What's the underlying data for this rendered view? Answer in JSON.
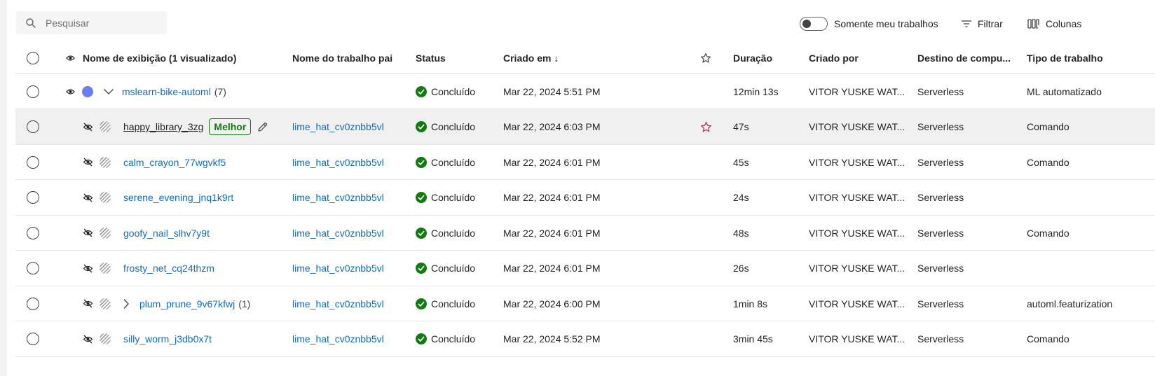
{
  "toolbar": {
    "search_placeholder": "Pesquisar",
    "toggle_label": "Somente meu trabalhos",
    "filter_label": "Filtrar",
    "columns_label": "Colunas"
  },
  "columns": {
    "display_name": "Nome de exibição (1 visualizado)",
    "parent_job": "Nome do trabalho pai",
    "status": "Status",
    "created_on": "Criado em ↓",
    "duration": "Duração",
    "created_by": "Criado por",
    "compute_target": "Destino de compu...",
    "job_type": "Tipo de trabalho"
  },
  "parent_row": {
    "name": "mslearn-bike-automl",
    "count": "(7)",
    "status": "Concluído",
    "created": "Mar 22, 2024 5:51 PM",
    "duration": "12min 13s",
    "created_by": "VITOR YUSKE WAT...",
    "compute": "Serverless",
    "job_type": "ML automatizado",
    "dot_color": "#6b7ff2"
  },
  "rows": [
    {
      "name": "happy_library_3zg",
      "badge": "Melhor",
      "parent": "lime_hat_cv0znbb5vl",
      "status": "Concluído",
      "created": "Mar 22, 2024 6:03 PM",
      "duration": "47s",
      "created_by": "VITOR YUSKE WAT...",
      "compute": "Serverless",
      "job_type": "Comando"
    },
    {
      "name": "calm_crayon_77wgvkf5",
      "parent": "lime_hat_cv0znbb5vl",
      "status": "Concluído",
      "created": "Mar 22, 2024 6:01 PM",
      "duration": "45s",
      "created_by": "VITOR YUSKE WAT...",
      "compute": "Serverless",
      "job_type": "Comando"
    },
    {
      "name": "serene_evening_jnq1k9rt",
      "parent": "lime_hat_cv0znbb5vl",
      "status": "Concluído",
      "created": "Mar 22, 2024 6:01 PM",
      "duration": "24s",
      "created_by": "VITOR YUSKE WAT...",
      "compute": "Serverless",
      "job_type": ""
    },
    {
      "name": "goofy_nail_slhv7y9t",
      "parent": "lime_hat_cv0znbb5vl",
      "status": "Concluído",
      "created": "Mar 22, 2024 6:01 PM",
      "duration": "48s",
      "created_by": "VITOR YUSKE WAT...",
      "compute": "Serverless",
      "job_type": "Comando"
    },
    {
      "name": "frosty_net_cq24thzm",
      "parent": "lime_hat_cv0znbb5vl",
      "status": "Concluído",
      "created": "Mar 22, 2024 6:01 PM",
      "duration": "26s",
      "created_by": "VITOR YUSKE WAT...",
      "compute": "Serverless",
      "job_type": ""
    },
    {
      "name": "plum_prune_9v67kfwj",
      "count": "(1)",
      "parent": "lime_hat_cv0znbb5vl",
      "status": "Concluído",
      "created": "Mar 22, 2024 6:00 PM",
      "duration": "1min 8s",
      "created_by": "VITOR YUSKE WAT...",
      "compute": "Serverless",
      "job_type": "automl.featurization"
    },
    {
      "name": "silly_worm_j3db0x7t",
      "parent": "lime_hat_cv0znbb5vl",
      "status": "Concluído",
      "created": "Mar 22, 2024 5:52 PM",
      "duration": "3min 45s",
      "created_by": "VITOR YUSKE WAT...",
      "compute": "Serverless",
      "job_type": "Comando"
    }
  ],
  "colors": {
    "link": "#0f6cbd",
    "success": "#107c10",
    "favorite_star": "#c4314b"
  }
}
